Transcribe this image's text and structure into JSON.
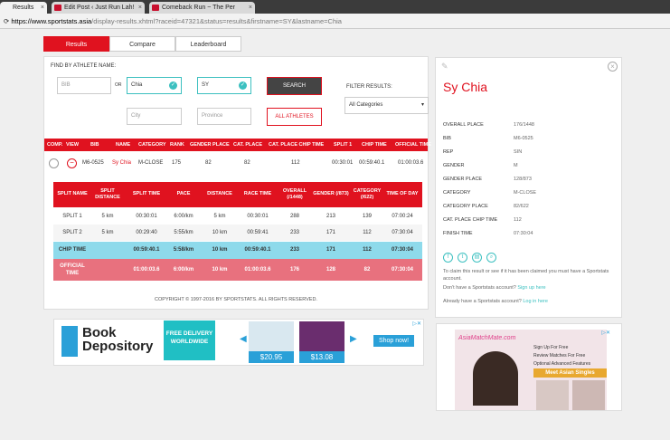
{
  "browser": {
    "tabs": [
      {
        "title": "Results",
        "close": "×"
      },
      {
        "title": "Edit Post ‹ Just Run Lah!",
        "close": "×"
      },
      {
        "title": "Comeback Run ~ The Per",
        "close": "×"
      }
    ],
    "url_domain": "https://www.sportstats.asia",
    "url_path": "/display-results.xhtml?raceid=47321&status=results&firstname=SY&lastname=Chia"
  },
  "nav_tabs": [
    {
      "label": "Results",
      "active": true
    },
    {
      "label": "Compare",
      "active": false
    },
    {
      "label": "Leaderboard",
      "active": false
    }
  ],
  "search": {
    "find_label": "FIND BY ATHLETE NAME:",
    "bib_placeholder": "BIB",
    "or_label": "OR",
    "lastname_value": "Chia",
    "firstname_value": "SY",
    "city_placeholder": "City",
    "province_placeholder": "Province",
    "search_label": "SEARCH",
    "all_athletes_label": "ALL ATHLETES",
    "filter_label": "FILTER RESULTS:",
    "filter_value": "All Categories"
  },
  "results_table": {
    "headers": [
      "COMP.",
      "VIEW",
      "BIB",
      "NAME",
      "CATEGORY",
      "RANK",
      "GENDER PLACE",
      "CAT. PLACE",
      "CAT. PLACE CHIP TIME",
      "SPLIT 1",
      "CHIP TIME",
      "OFFICIAL TIME"
    ],
    "row": {
      "bib": "M6-0525",
      "name": "Sy Chia",
      "category": "M-CLOSE",
      "rank": "175",
      "gender_place": "82",
      "cat_place": "82",
      "cat_place_chip": "112",
      "split1": "00:30:01",
      "chip_time": "00:59:40.1",
      "official_time": "01:00:03.6"
    }
  },
  "splits": {
    "headers": [
      "SPLIT NAME",
      "SPLIT DISTANCE",
      "SPLIT TIME",
      "PACE",
      "DISTANCE",
      "RACE TIME",
      "OVERALL (/1448)",
      "GENDER (/873)",
      "CATEGORY (/622)",
      "TIME OF DAY"
    ],
    "rows": [
      [
        "SPLIT 1",
        "5 km",
        "00:30:01",
        "6:00/km",
        "5 km",
        "00:30:01",
        "288",
        "213",
        "139",
        "07:00:24"
      ],
      [
        "SPLIT 2",
        "5 km",
        "00:29:40",
        "5:55/km",
        "10 km",
        "00:59:41",
        "233",
        "171",
        "112",
        "07:30:04"
      ],
      [
        "CHIP TIME",
        "",
        "00:59:40.1",
        "5:58/km",
        "10 km",
        "00:59:40.1",
        "233",
        "171",
        "112",
        "07:30:04"
      ],
      [
        "OFFICIAL TIME",
        "",
        "01:00:03.6",
        "6:00/km",
        "10 km",
        "01:00:03.6",
        "176",
        "128",
        "82",
        "07:30:04"
      ]
    ]
  },
  "footer": "COPYRIGHT © 1997-2016 BY SPORTSTATS. ALL RIGHTS RESERVED.",
  "athlete": {
    "name": "Sy Chia",
    "fields": [
      {
        "k": "OVERALL PLACE",
        "v": "176/1448"
      },
      {
        "k": "BIB",
        "v": "M6-0525"
      },
      {
        "k": "REP",
        "v": "SIN"
      },
      {
        "k": "GENDER",
        "v": "M"
      },
      {
        "k": "GENDER PLACE",
        "v": "128/873"
      },
      {
        "k": "CATEGORY",
        "v": "M-CLOSE"
      },
      {
        "k": "CATEGORY PLACE",
        "v": "82/622"
      },
      {
        "k": "CAT. PLACE CHIP TIME",
        "v": "112"
      },
      {
        "k": "FINISH TIME",
        "v": "07:30:04"
      }
    ],
    "claim_text": "To claim this result or see if it has been claimed you must have a Sportstats account.",
    "no_account_text": "Don't have a Sportstats account?",
    "signup_link": "Sign up here",
    "have_account_text": "Already have a Sportstats account?",
    "login_link": "Log in here"
  },
  "ad_left": {
    "brand_line1": "Book",
    "brand_line2": "Depository",
    "banner": "FREE DELIVERY WORLDWIDE",
    "price1": "$20.95",
    "price2": "$13.08",
    "cta": "Shop now!"
  },
  "ad_right": {
    "brand": "AsiaMatchMate.com",
    "items": [
      "Sign Up For Free",
      "Review Matches For Free",
      "Optional Advanced Features"
    ],
    "headline": "Meet Asian Singles"
  },
  "colors": {
    "brand_red": "#e0121f",
    "teal": "#3cc0c0",
    "chip_blue": "#8edaeb",
    "official_pink": "#e8717e"
  }
}
